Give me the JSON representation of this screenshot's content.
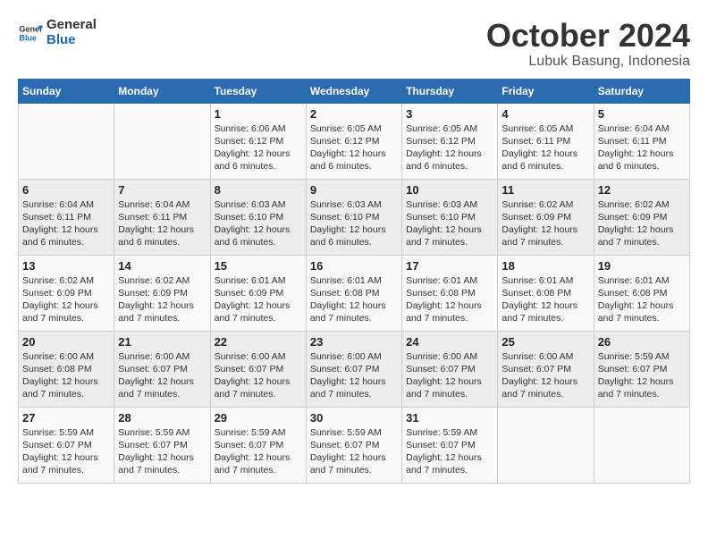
{
  "header": {
    "logo_line1": "General",
    "logo_line2": "Blue",
    "month": "October 2024",
    "location": "Lubuk Basung, Indonesia"
  },
  "days_of_week": [
    "Sunday",
    "Monday",
    "Tuesday",
    "Wednesday",
    "Thursday",
    "Friday",
    "Saturday"
  ],
  "weeks": [
    [
      {
        "day": "",
        "detail": ""
      },
      {
        "day": "",
        "detail": ""
      },
      {
        "day": "1",
        "detail": "Sunrise: 6:06 AM\nSunset: 6:12 PM\nDaylight: 12 hours and 6 minutes."
      },
      {
        "day": "2",
        "detail": "Sunrise: 6:05 AM\nSunset: 6:12 PM\nDaylight: 12 hours and 6 minutes."
      },
      {
        "day": "3",
        "detail": "Sunrise: 6:05 AM\nSunset: 6:12 PM\nDaylight: 12 hours and 6 minutes."
      },
      {
        "day": "4",
        "detail": "Sunrise: 6:05 AM\nSunset: 6:11 PM\nDaylight: 12 hours and 6 minutes."
      },
      {
        "day": "5",
        "detail": "Sunrise: 6:04 AM\nSunset: 6:11 PM\nDaylight: 12 hours and 6 minutes."
      }
    ],
    [
      {
        "day": "6",
        "detail": "Sunrise: 6:04 AM\nSunset: 6:11 PM\nDaylight: 12 hours and 6 minutes."
      },
      {
        "day": "7",
        "detail": "Sunrise: 6:04 AM\nSunset: 6:11 PM\nDaylight: 12 hours and 6 minutes."
      },
      {
        "day": "8",
        "detail": "Sunrise: 6:03 AM\nSunset: 6:10 PM\nDaylight: 12 hours and 6 minutes."
      },
      {
        "day": "9",
        "detail": "Sunrise: 6:03 AM\nSunset: 6:10 PM\nDaylight: 12 hours and 6 minutes."
      },
      {
        "day": "10",
        "detail": "Sunrise: 6:03 AM\nSunset: 6:10 PM\nDaylight: 12 hours and 7 minutes."
      },
      {
        "day": "11",
        "detail": "Sunrise: 6:02 AM\nSunset: 6:09 PM\nDaylight: 12 hours and 7 minutes."
      },
      {
        "day": "12",
        "detail": "Sunrise: 6:02 AM\nSunset: 6:09 PM\nDaylight: 12 hours and 7 minutes."
      }
    ],
    [
      {
        "day": "13",
        "detail": "Sunrise: 6:02 AM\nSunset: 6:09 PM\nDaylight: 12 hours and 7 minutes."
      },
      {
        "day": "14",
        "detail": "Sunrise: 6:02 AM\nSunset: 6:09 PM\nDaylight: 12 hours and 7 minutes."
      },
      {
        "day": "15",
        "detail": "Sunrise: 6:01 AM\nSunset: 6:09 PM\nDaylight: 12 hours and 7 minutes."
      },
      {
        "day": "16",
        "detail": "Sunrise: 6:01 AM\nSunset: 6:08 PM\nDaylight: 12 hours and 7 minutes."
      },
      {
        "day": "17",
        "detail": "Sunrise: 6:01 AM\nSunset: 6:08 PM\nDaylight: 12 hours and 7 minutes."
      },
      {
        "day": "18",
        "detail": "Sunrise: 6:01 AM\nSunset: 6:08 PM\nDaylight: 12 hours and 7 minutes."
      },
      {
        "day": "19",
        "detail": "Sunrise: 6:01 AM\nSunset: 6:08 PM\nDaylight: 12 hours and 7 minutes."
      }
    ],
    [
      {
        "day": "20",
        "detail": "Sunrise: 6:00 AM\nSunset: 6:08 PM\nDaylight: 12 hours and 7 minutes."
      },
      {
        "day": "21",
        "detail": "Sunrise: 6:00 AM\nSunset: 6:07 PM\nDaylight: 12 hours and 7 minutes."
      },
      {
        "day": "22",
        "detail": "Sunrise: 6:00 AM\nSunset: 6:07 PM\nDaylight: 12 hours and 7 minutes."
      },
      {
        "day": "23",
        "detail": "Sunrise: 6:00 AM\nSunset: 6:07 PM\nDaylight: 12 hours and 7 minutes."
      },
      {
        "day": "24",
        "detail": "Sunrise: 6:00 AM\nSunset: 6:07 PM\nDaylight: 12 hours and 7 minutes."
      },
      {
        "day": "25",
        "detail": "Sunrise: 6:00 AM\nSunset: 6:07 PM\nDaylight: 12 hours and 7 minutes."
      },
      {
        "day": "26",
        "detail": "Sunrise: 5:59 AM\nSunset: 6:07 PM\nDaylight: 12 hours and 7 minutes."
      }
    ],
    [
      {
        "day": "27",
        "detail": "Sunrise: 5:59 AM\nSunset: 6:07 PM\nDaylight: 12 hours and 7 minutes."
      },
      {
        "day": "28",
        "detail": "Sunrise: 5:59 AM\nSunset: 6:07 PM\nDaylight: 12 hours and 7 minutes."
      },
      {
        "day": "29",
        "detail": "Sunrise: 5:59 AM\nSunset: 6:07 PM\nDaylight: 12 hours and 7 minutes."
      },
      {
        "day": "30",
        "detail": "Sunrise: 5:59 AM\nSunset: 6:07 PM\nDaylight: 12 hours and 7 minutes."
      },
      {
        "day": "31",
        "detail": "Sunrise: 5:59 AM\nSunset: 6:07 PM\nDaylight: 12 hours and 7 minutes."
      },
      {
        "day": "",
        "detail": ""
      },
      {
        "day": "",
        "detail": ""
      }
    ]
  ]
}
